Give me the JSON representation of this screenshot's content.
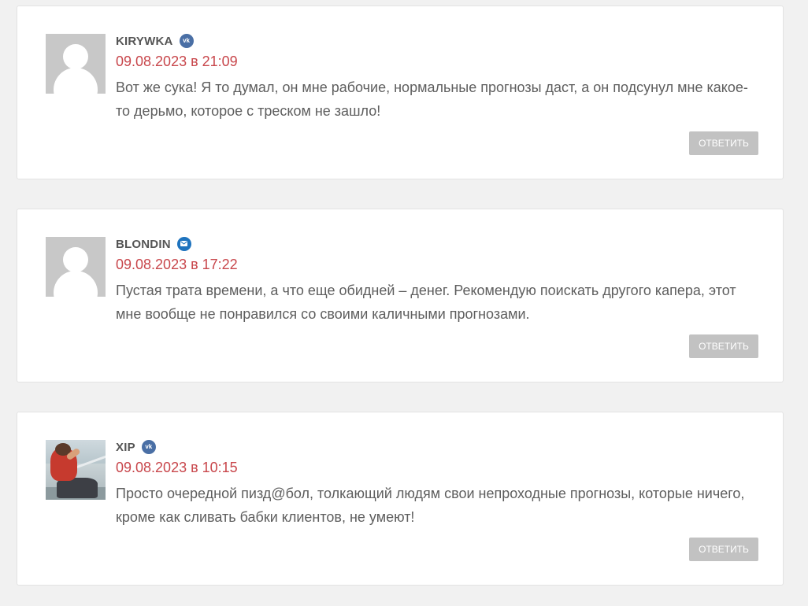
{
  "comments": [
    {
      "author": "KIRYWKA",
      "social_icon": "vk-icon",
      "social_label": "vk",
      "date": "09.08.2023 в 21:09",
      "text": "Вот же сука! Я то думал, он мне рабочие, нормальные прогнозы даст, а он подсунул мне какое-то дерьмо, которое с треском не зашло!",
      "reply_label": "ОТВЕТИТЬ",
      "avatar": "default-avatar"
    },
    {
      "author": "BLONDIN",
      "social_icon": "mail-icon",
      "social_label": "",
      "date": "09.08.2023 в 17:22",
      "text": "Пустая трата времени, а что еще обидней – денег. Рекомендую поискать другого капера, этот мне вообще не понравился со своими каличными прогнозами.",
      "reply_label": "ОТВЕТИТЬ",
      "avatar": "default-avatar"
    },
    {
      "author": "XIP",
      "social_icon": "vk-icon",
      "social_label": "vk",
      "date": "09.08.2023 в 10:15",
      "text": "Просто очередной пизд@бол, толкающий людям свои непроходные прогнозы, которые ничего, кроме как сливать бабки клиентов, не умеют!",
      "reply_label": "ОТВЕТИТЬ",
      "avatar": "photo-avatar"
    }
  ],
  "colors": {
    "background": "#f1f1f1",
    "card": "#ffffff",
    "date": "#c8464b",
    "text": "#5e5e5e",
    "author": "#555555",
    "reply_button": "#c2c2c2",
    "vk_icon": "#4a6fa5",
    "mail_icon": "#1e73be"
  }
}
